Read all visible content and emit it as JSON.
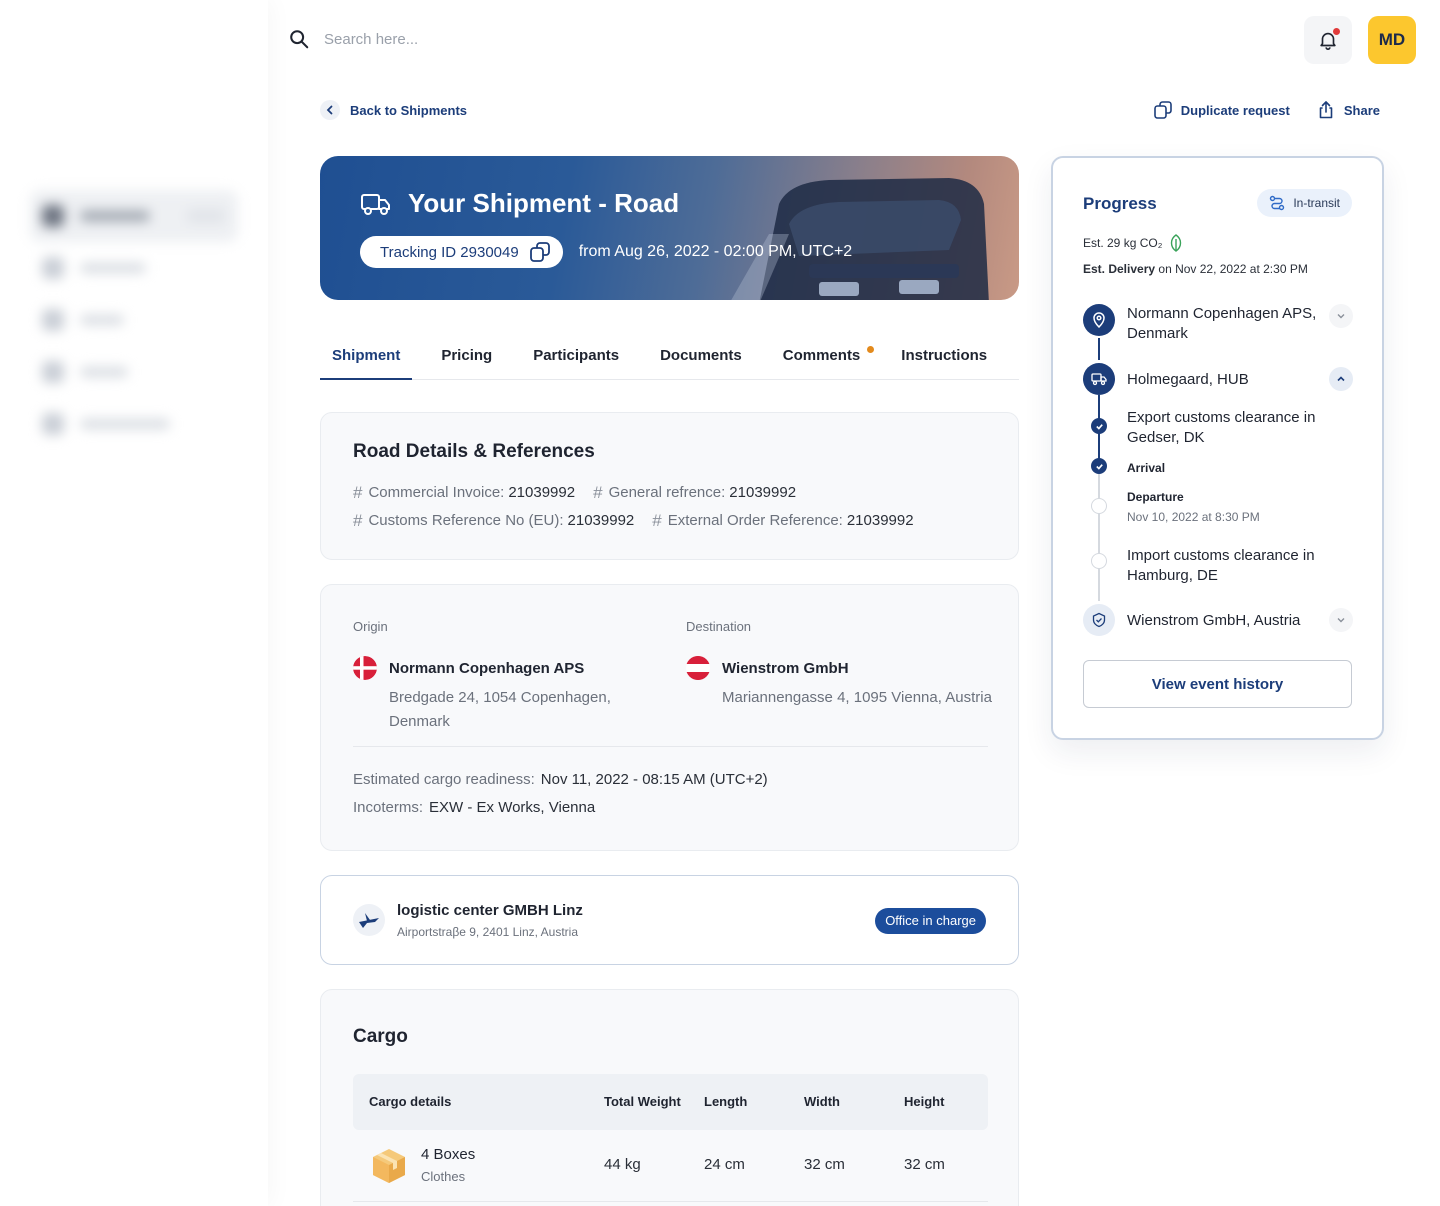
{
  "topbar": {
    "search_placeholder": "Search here...",
    "avatar_initials": "MD"
  },
  "nav": {
    "back_label": "Back to Shipments",
    "duplicate_label": "Duplicate request",
    "share_label": "Share"
  },
  "hero": {
    "title": "Your Shipment - Road",
    "tracking_label": "Tracking ID 2930049",
    "from_label": "from Aug 26, 2022 - 02:00 PM, UTC+2"
  },
  "tabs": [
    {
      "label": "Shipment",
      "active": true
    },
    {
      "label": "Pricing"
    },
    {
      "label": "Participants"
    },
    {
      "label": "Documents"
    },
    {
      "label": "Comments",
      "has_notification": true
    },
    {
      "label": "Instructions"
    }
  ],
  "references": {
    "title": "Road Details & References",
    "items": [
      {
        "label": "Commercial Invoice:",
        "value": "21039992"
      },
      {
        "label": "General refrence:",
        "value": "21039992"
      },
      {
        "label": "Customs Reference No (EU):",
        "value": "21039992"
      },
      {
        "label": "External Order Reference:",
        "value": "21039992"
      }
    ]
  },
  "route": {
    "origin_label": "Origin",
    "origin_company": "Normann Copenhagen APS",
    "origin_address": "Bredgade 24, 1054 Copenhagen, Denmark",
    "destination_label": "Destination",
    "destination_company": "Wienstrom GmbH",
    "destination_address": "Mariannengasse 4, 1095 Vienna, Austria",
    "readiness_label": "Estimated cargo readiness:",
    "readiness_value": "Nov 11, 2022 - 08:15 AM (UTC+2)",
    "incoterms_label": "Incoterms:",
    "incoterms_value": "EXW - Ex Works, Vienna"
  },
  "office": {
    "name": "logistic center GMBH Linz",
    "address": "Airportstraβe 9, 2401 Linz, Austria",
    "badge": "Office in charge"
  },
  "cargo": {
    "title": "Cargo",
    "columns": [
      "Cargo details",
      "Total Weight",
      "Length",
      "Width",
      "Height"
    ],
    "rows": [
      {
        "name": "4 Boxes",
        "category": "Clothes",
        "weight": "44 kg",
        "length": "24 cm",
        "width": "32 cm",
        "height": "32 cm"
      }
    ]
  },
  "progress": {
    "title": "Progress",
    "status": "In-transit",
    "co2": "Est. 29 kg CO₂",
    "delivery_label": "Est. Delivery",
    "delivery_value": "on Nov 22, 2022 at 2:30 PM",
    "steps": {
      "origin": "Normann Copenhagen APS, Denmark",
      "hub": "Holmegaard, HUB",
      "export": "Export customs clearance in Gedser, DK",
      "arrival": "Arrival",
      "departure": "Departure",
      "departure_time": "Nov 10, 2022 at 8:30 PM",
      "import": "Import customs clearance in Hamburg, DE",
      "destination": "Wienstrom GmbH, Austria"
    },
    "view_history": "View event history"
  },
  "colors": {
    "primary": "#1c3d7a",
    "accent_yellow": "#fcc72e",
    "notification": "#e03a3a",
    "comment_dot": "#e38a1c",
    "badge_blue": "#1c4d9c"
  }
}
